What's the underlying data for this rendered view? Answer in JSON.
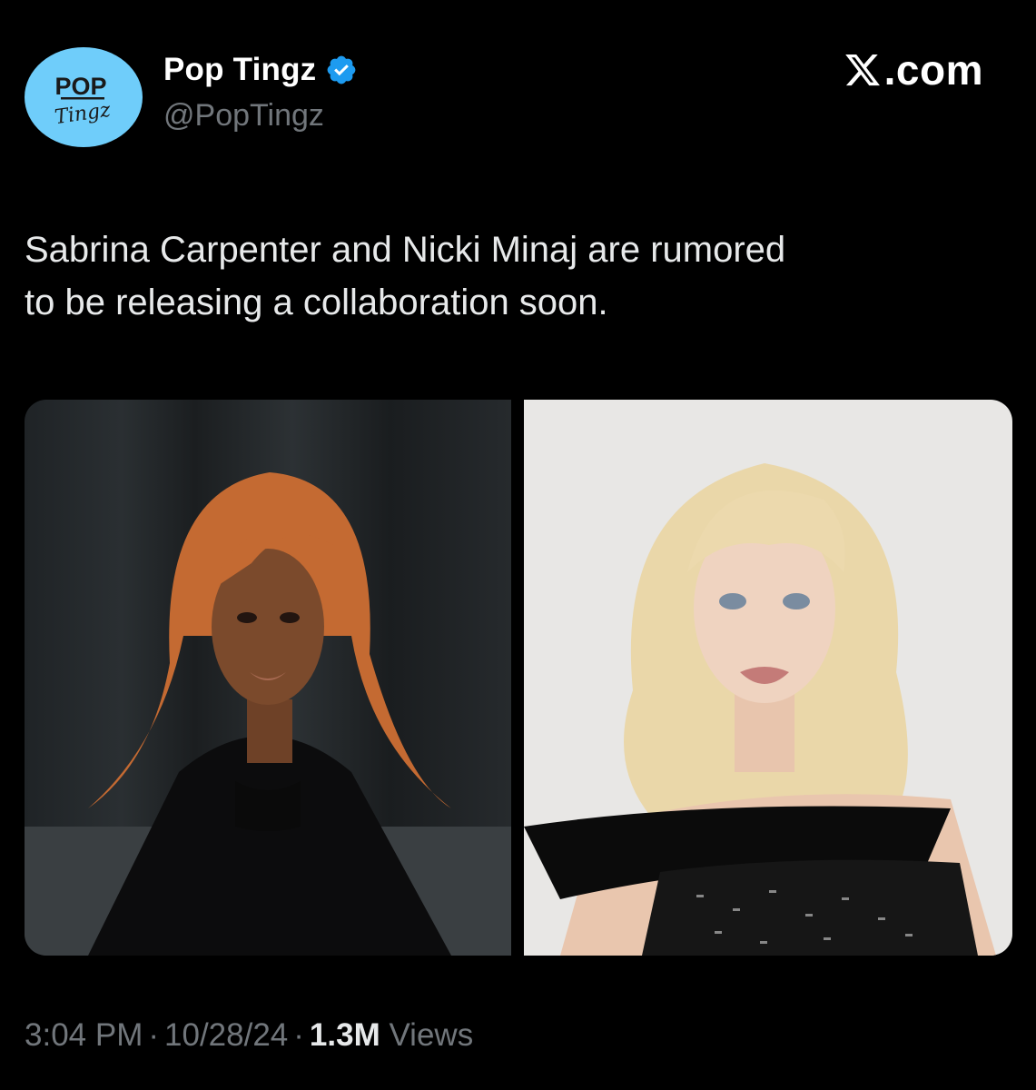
{
  "account": {
    "display_name": "Pop Tingz",
    "handle": "@PopTingz",
    "avatar_text_top": "POP",
    "avatar_text_bottom": "Tingz",
    "avatar_color": "#6fcdfa",
    "verified_icon": "verified-badge-icon",
    "verified_color": "#1d9bf0"
  },
  "brand": {
    "icon": "x-logo-icon",
    "text": ".com"
  },
  "tweet": {
    "text_line1": "Sabrina Carpenter and Nicki Minaj are rumored",
    "text_line2": "to be releasing a collaboration soon."
  },
  "media": [
    {
      "subject": "woman with copper hair in black turtleneck"
    },
    {
      "subject": "blonde woman in black off-shoulder top"
    }
  ],
  "meta": {
    "time": "3:04 PM",
    "separator": "·",
    "date": "10/28/24",
    "views_count": "1.3M",
    "views_label": "Views"
  },
  "colors": {
    "background": "#000000",
    "text_primary": "#e7e9ea",
    "text_secondary": "#71767b",
    "accent": "#1d9bf0"
  }
}
